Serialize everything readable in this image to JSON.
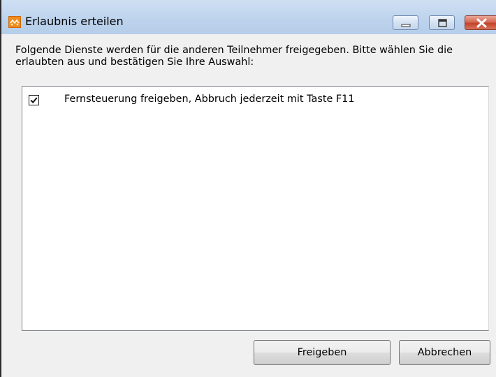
{
  "window": {
    "title": "Erlaubnis erteilen",
    "icon": "app-logo-icon",
    "controls": [
      "minimize-icon",
      "maximize-icon",
      "close-icon"
    ]
  },
  "dialog": {
    "instruction": "Folgende Dienste werden für die anderen Teilnehmer freigegeben. Bitte wählen Sie die erlaubten aus und bestätigen Sie Ihre Auswahl:",
    "services": [
      {
        "label": "Fernsteuerung freigeben, Abbruch jederzeit mit Taste F11",
        "checked": true
      }
    ]
  },
  "buttons": {
    "ok_label": "Freigeben",
    "cancel_label": "Abbrechen"
  },
  "colors": {
    "title_bar": "#bcd2ec",
    "close_button": "#c2432b",
    "app_icon": "#f28c18",
    "dialog_bg": "#f0f0f0"
  }
}
